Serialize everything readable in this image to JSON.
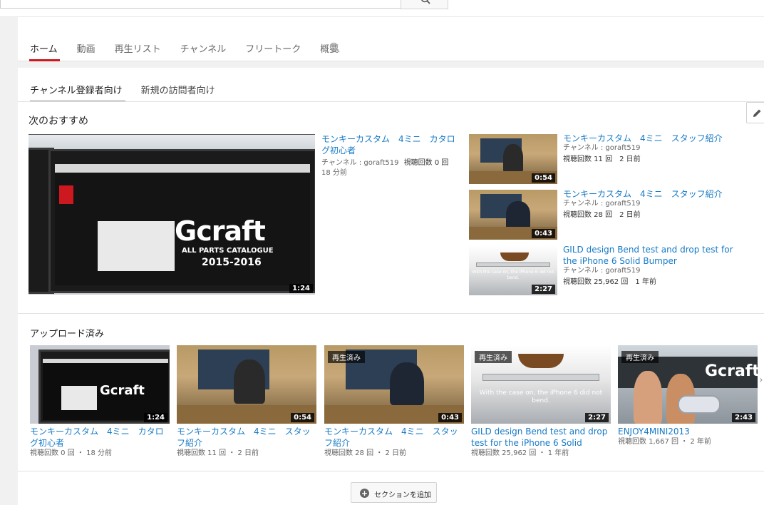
{
  "tabs": [
    {
      "label": "ホーム",
      "active": true
    },
    {
      "label": "動画"
    },
    {
      "label": "再生リスト"
    },
    {
      "label": "チャンネル"
    },
    {
      "label": "フリートーク"
    },
    {
      "label": "概要"
    }
  ],
  "subtabs": [
    {
      "label": "チャンネル登録者向け",
      "active": true
    },
    {
      "label": "新規の訪問者向け"
    }
  ],
  "recommended": {
    "title": "次のおすすめ",
    "featured": {
      "title": "モンキーカスタム　4ミニ　カタログ初心者",
      "channel": "チャンネル : goraft519",
      "views": "視聴回数 0 回",
      "age": "18 分前",
      "duration": "1:24",
      "logo_text": "Gcraft",
      "catalogue_text": "ALL PARTS CATALOGUE",
      "years_text": "2015-2016"
    },
    "side": [
      {
        "title": "モンキーカスタム　4ミニ　スタッフ紹介",
        "channel": "チャンネル : goraft519",
        "views_age": "視聴回数 11 回　2 日前",
        "duration": "0:54"
      },
      {
        "title": "モンキーカスタム　4ミニ　スタッフ紹介",
        "channel": "チャンネル : goraft519",
        "views_age": "視聴回数 28 回　2 日前",
        "duration": "0:43"
      },
      {
        "title": "GILD design Bend test and drop test for the iPhone 6 Solid Bumper",
        "channel": "チャンネル : goraft519",
        "views_age": "視聴回数 25,962 回　1 年前",
        "duration": "2:27",
        "caption": "With the case on, the iPhone 6 did not bend."
      }
    ]
  },
  "uploads": {
    "title": "アップロード済み",
    "watched_label": "再生済み",
    "items": [
      {
        "title": "モンキーカスタム　4ミニ　カタログ初心者",
        "meta": "視聴回数 0 回 ・ 18 分前",
        "duration": "1:24",
        "watched": false
      },
      {
        "title": "モンキーカスタム　4ミニ　スタッフ紹介",
        "meta": "視聴回数 11 回 ・ 2 日前",
        "duration": "0:54",
        "watched": false
      },
      {
        "title": "モンキーカスタム　4ミニ　スタッフ紹介",
        "meta": "視聴回数 28 回 ・ 2 日前",
        "duration": "0:43",
        "watched": true
      },
      {
        "title": "GILD design Bend test and drop test for the iPhone 6 Solid Bumper",
        "meta": "視聴回数 25,962 回 ・ 1 年前",
        "duration": "2:27",
        "watched": true
      },
      {
        "title": "ENJOY4MINI2013",
        "meta": "視聴回数 1,667 回 ・ 2 年前",
        "duration": "2:43",
        "watched": true
      }
    ]
  },
  "add_section_label": "セクションを追加",
  "colors": {
    "accent": "#cc181e",
    "link": "#167ac6"
  }
}
